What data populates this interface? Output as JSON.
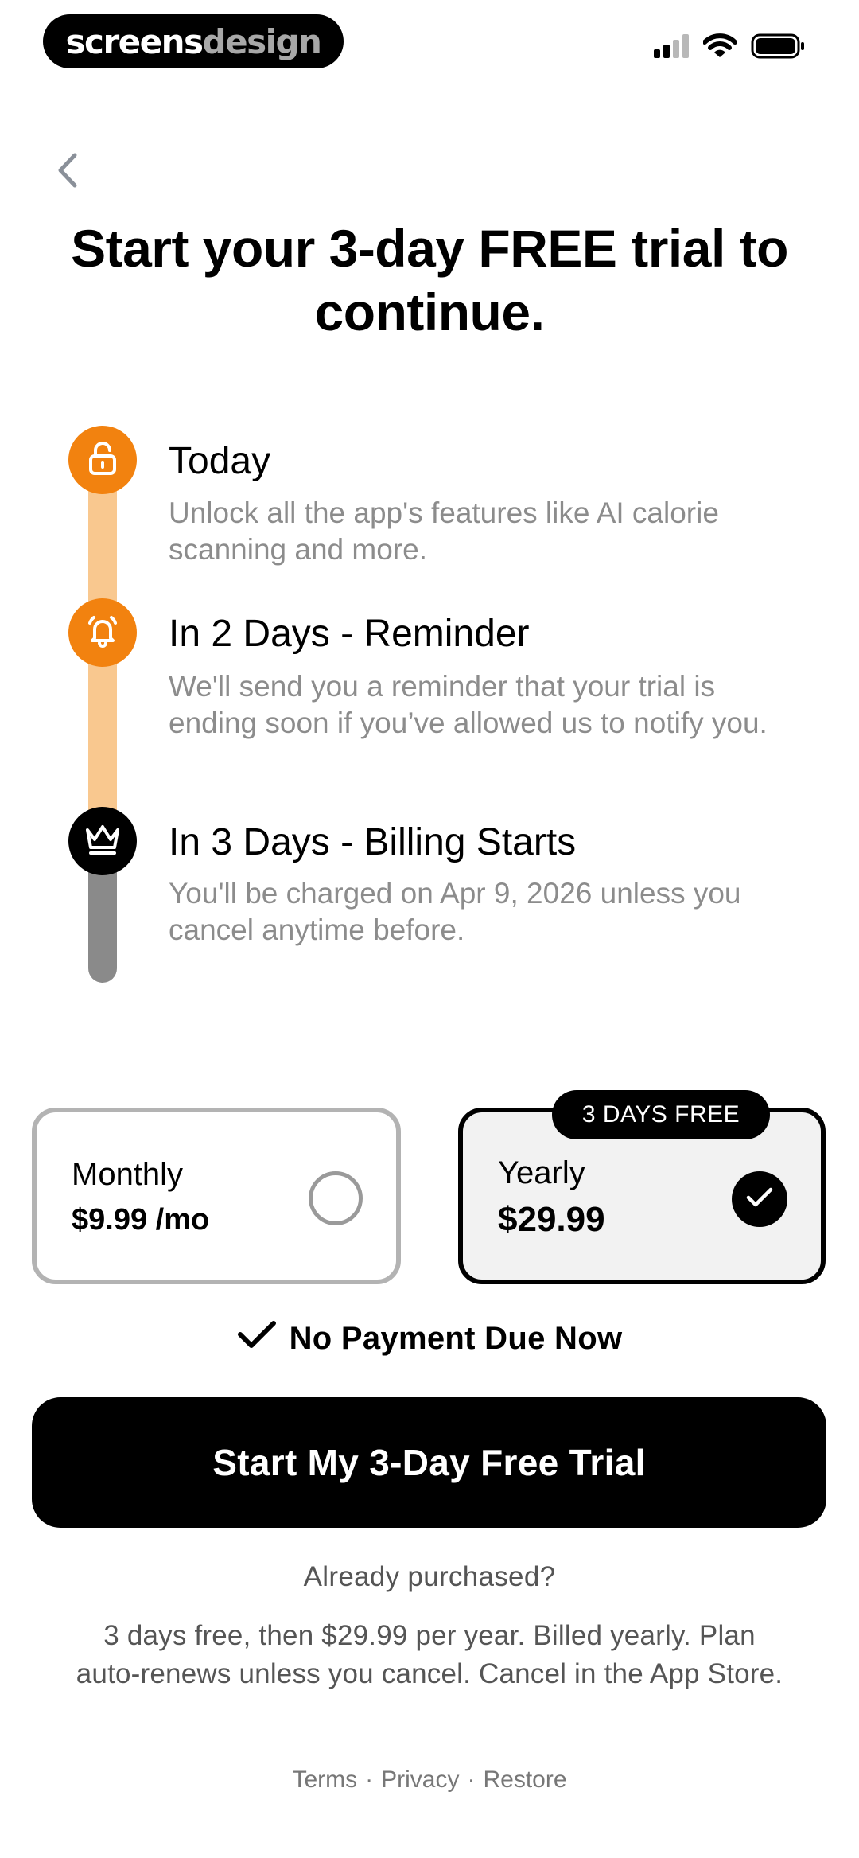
{
  "status_bar": {
    "brand_part1": "screens",
    "brand_part2": "design",
    "icons": [
      "cellular-signal-icon",
      "wifi-icon",
      "battery-icon"
    ]
  },
  "header": {
    "back_icon": "chevron-left-icon",
    "title": "Start your 3-day FREE trial to continue."
  },
  "timeline": {
    "steps": [
      {
        "icon": "unlock-icon",
        "title": "Today",
        "description": "Unlock all the app's features like AI calorie scanning and more."
      },
      {
        "icon": "bell-icon",
        "title": "In 2 Days - Reminder",
        "description": "We'll send you a reminder that your trial is ending soon if you’ve allowed us to notify you."
      },
      {
        "icon": "crown-icon",
        "title": "In 3 Days - Billing Starts",
        "description": "You'll be charged on Apr 9, 2026 unless you cancel anytime before."
      }
    ]
  },
  "plans": {
    "monthly": {
      "name": "Monthly",
      "price": "$9.99 /mo",
      "selected": false
    },
    "yearly": {
      "name": "Yearly",
      "price": "$29.99",
      "badge": "3 DAYS FREE",
      "selected": true
    }
  },
  "no_payment": "No Payment Due Now",
  "cta_label": "Start My 3-Day Free Trial",
  "already_purchased": "Already purchased?",
  "terms_text": "3 days free, then $29.99 per year. Billed yearly. Plan auto-renews unless you cancel. Cancel in the App Store.",
  "footer_links": {
    "terms": "Terms",
    "privacy": "Privacy",
    "restore": "Restore",
    "separator": "·"
  },
  "colors": {
    "accent_orange": "#f2820f",
    "track_orange": "#f9c88f",
    "track_gray": "#8a8a8a",
    "text_muted": "#8c8c8c"
  }
}
